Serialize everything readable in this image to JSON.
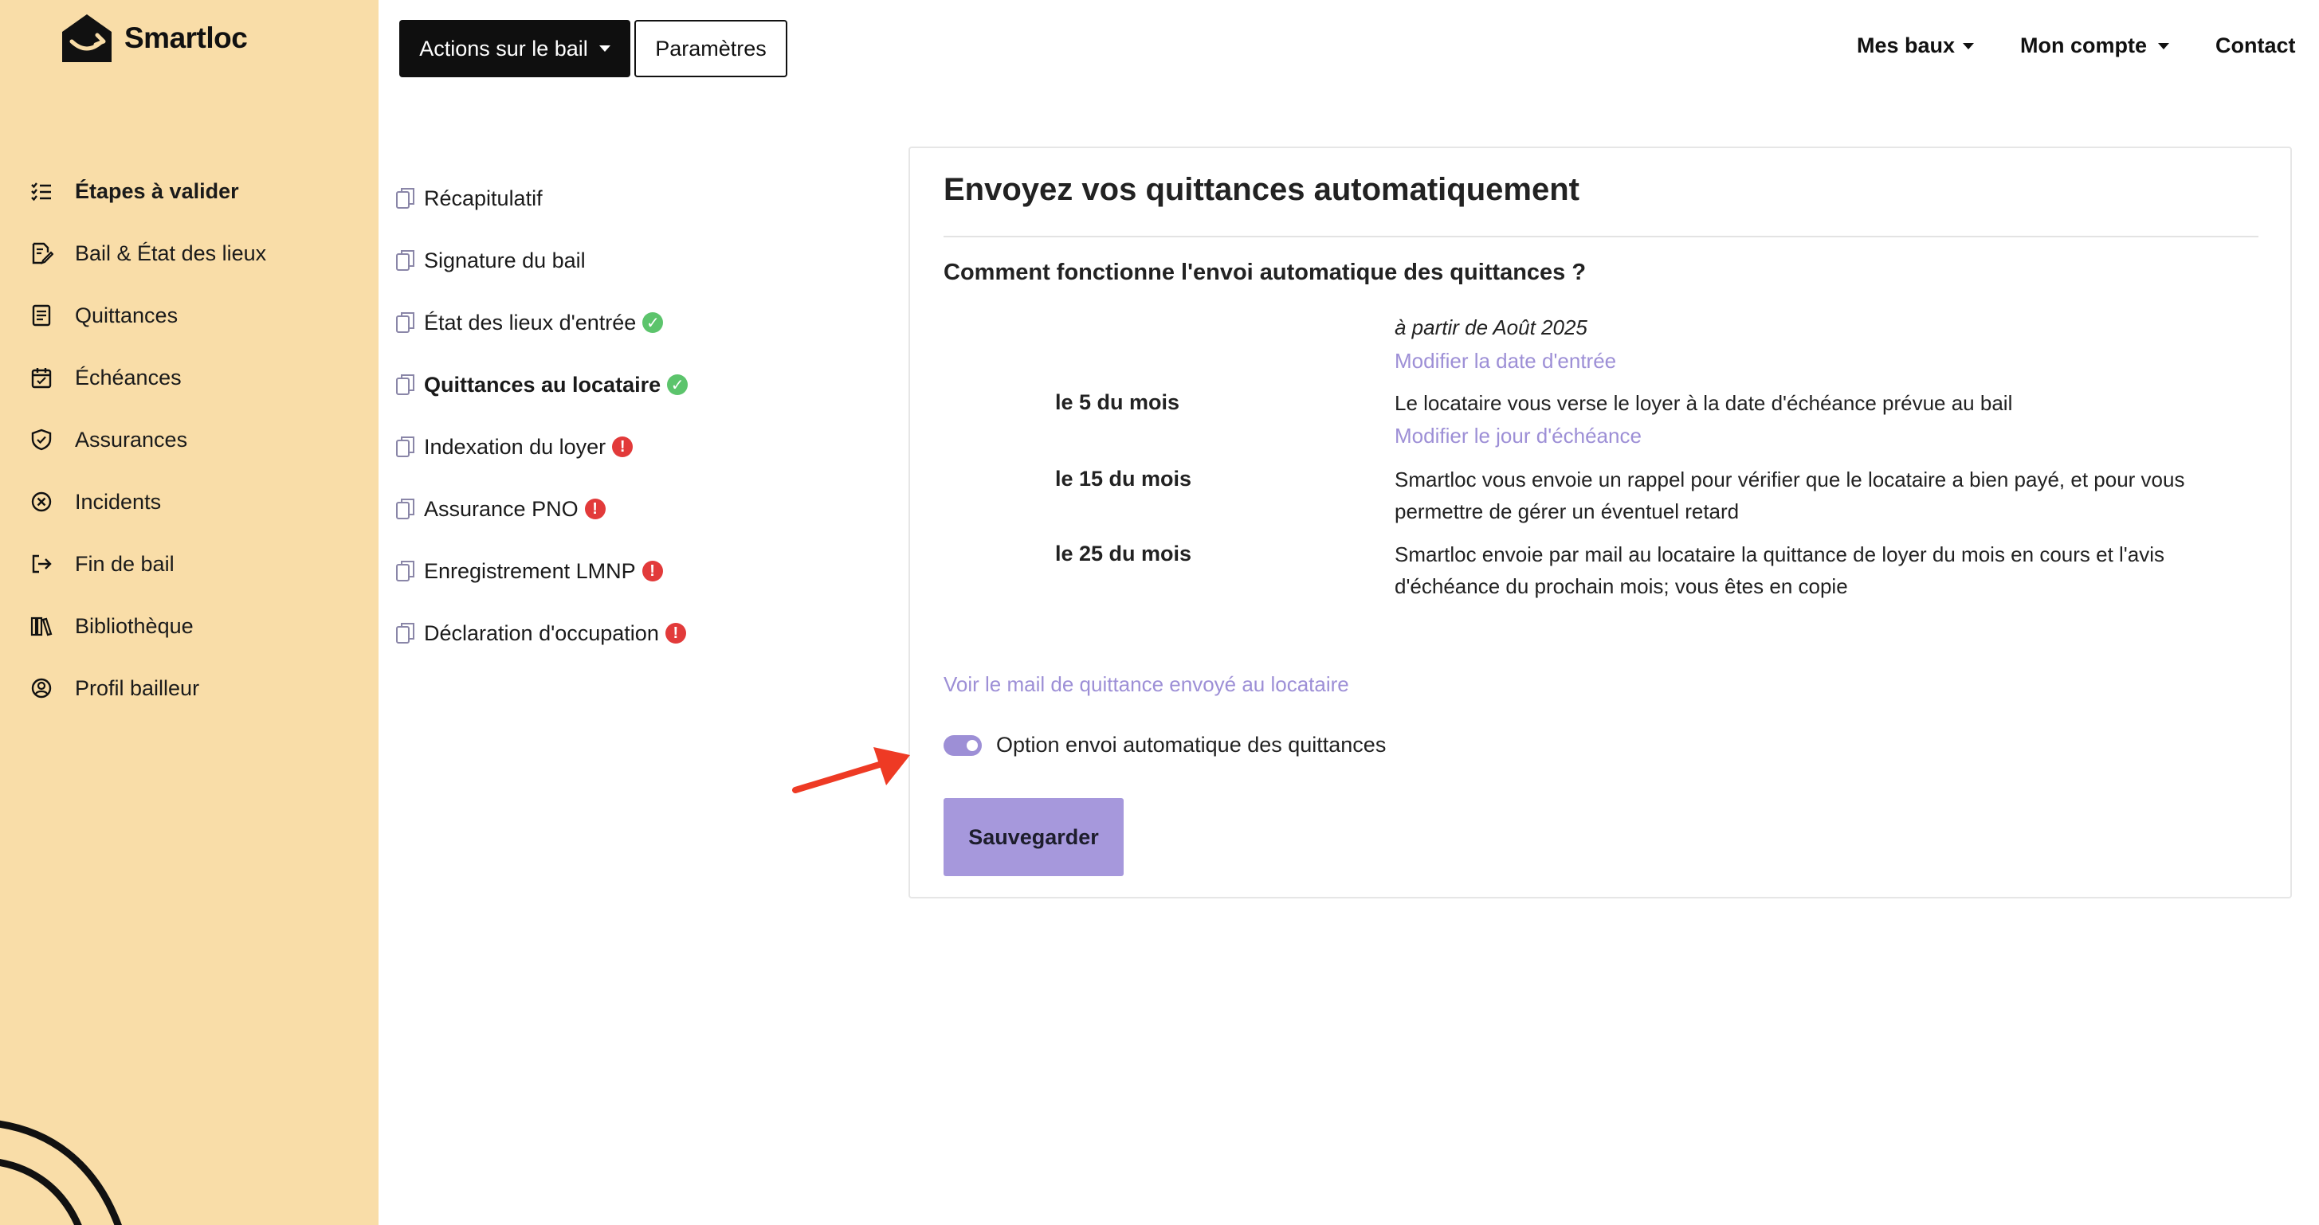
{
  "brand": {
    "name": "Smartloc",
    "logo_icon": "house-arrow-logo"
  },
  "sidebar": {
    "items": [
      {
        "label": "Étapes à valider",
        "icon": "checklist-icon",
        "active": true
      },
      {
        "label": "Bail & État des lieux",
        "icon": "document-edit-icon",
        "active": false
      },
      {
        "label": "Quittances",
        "icon": "receipt-icon",
        "active": false
      },
      {
        "label": "Échéances",
        "icon": "calendar-icon",
        "active": false
      },
      {
        "label": "Assurances",
        "icon": "shield-icon",
        "active": false
      },
      {
        "label": "Incidents",
        "icon": "circle-x-icon",
        "active": false
      },
      {
        "label": "Fin de bail",
        "icon": "exit-icon",
        "active": false
      },
      {
        "label": "Bibliothèque",
        "icon": "books-icon",
        "active": false
      },
      {
        "label": "Profil bailleur",
        "icon": "user-circle-icon",
        "active": false
      }
    ]
  },
  "toolbar": {
    "actions_label": "Actions sur le bail",
    "params_label": "Paramètres"
  },
  "topnav": {
    "leases": "Mes baux",
    "account": "Mon compte",
    "contact": "Contact"
  },
  "steps": [
    {
      "label": "Récapitulatif",
      "status": null,
      "active": false
    },
    {
      "label": "Signature du bail",
      "status": null,
      "active": false
    },
    {
      "label": "État des lieux d'entrée",
      "status": "ok",
      "active": false
    },
    {
      "label": "Quittances au locataire",
      "status": "ok",
      "active": true
    },
    {
      "label": "Indexation du loyer",
      "status": "warn",
      "active": false
    },
    {
      "label": "Assurance PNO",
      "status": "warn",
      "active": false
    },
    {
      "label": "Enregistrement LMNP",
      "status": "warn",
      "active": false
    },
    {
      "label": "Déclaration d'occupation",
      "status": "warn",
      "active": false
    }
  ],
  "card": {
    "title": "Envoyez vos quittances automatiquement",
    "subtitle": "Comment fonctionne l'envoi automatique des quittances ?",
    "intro_date": "à partir de Août 2025",
    "intro_link": "Modifier la date d'entrée",
    "rows": [
      {
        "label": "le 5 du mois",
        "line1": "Le locataire vous verse le loyer à la date d'échéance prévue au bail",
        "line2": "",
        "link": "Modifier le jour d'échéance"
      },
      {
        "label": "le 15 du mois",
        "line1": "Smartloc vous envoie un rappel pour vérifier que le locataire a bien payé, et pour vous",
        "line2": "permettre de gérer un éventuel retard",
        "link": ""
      },
      {
        "label": "le 25 du mois",
        "line1": "Smartloc envoie par mail au locataire la quittance de loyer du mois en cours et l'avis",
        "line2": "d'échéance du prochain mois; vous êtes en copie",
        "link": ""
      }
    ],
    "mail_link": "Voir le mail de quittance envoyé au locataire",
    "toggle_label": "Option envoi automatique des quittances",
    "toggle_on": true,
    "save_label": "Sauvegarder"
  },
  "colors": {
    "sidebar_bg": "#f9dda8",
    "accent": "#9d8fd6",
    "ok": "#5cc46c",
    "warn": "#e23a3a",
    "arrow": "#ee3a24"
  }
}
